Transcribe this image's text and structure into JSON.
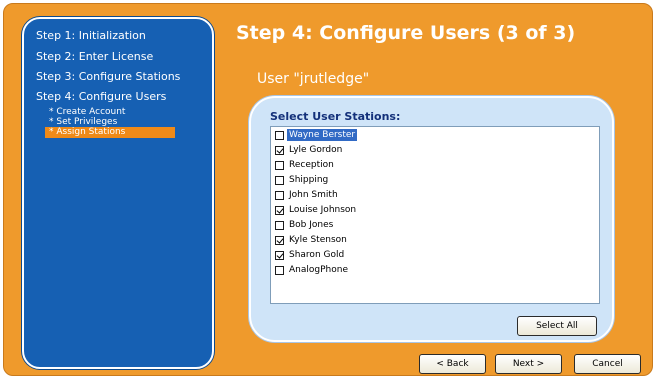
{
  "sidebar": {
    "steps": [
      {
        "label": "Step 1: Initialization"
      },
      {
        "label": "Step 2: Enter License"
      },
      {
        "label": "Step 3: Configure Stations"
      },
      {
        "label": "Step 4: Configure Users"
      }
    ],
    "substeps": [
      {
        "label": "* Create Account"
      },
      {
        "label": "* Set Privileges"
      },
      {
        "label": "* Assign Stations",
        "active": true
      }
    ]
  },
  "main": {
    "heading": "Step 4: Configure Users (3 of 3)",
    "user_label": "User \"jrutledge\"",
    "panel_title": "Select User Stations:",
    "stations": [
      {
        "label": "Wayne Berster",
        "checked": false,
        "highlighted": true
      },
      {
        "label": "Lyle Gordon",
        "checked": true
      },
      {
        "label": "Reception",
        "checked": false
      },
      {
        "label": "Shipping",
        "checked": false
      },
      {
        "label": "John Smith",
        "checked": false
      },
      {
        "label": "Louise Johnson",
        "checked": true
      },
      {
        "label": "Bob Jones",
        "checked": false
      },
      {
        "label": "Kyle Stenson",
        "checked": true
      },
      {
        "label": "Sharon Gold",
        "checked": true
      },
      {
        "label": "AnalogPhone",
        "checked": false
      }
    ],
    "select_all_label": "Select All"
  },
  "footer": {
    "back_label": "< Back",
    "next_label": "Next >",
    "cancel_label": "Cancel"
  },
  "colors": {
    "frame_orange": "#ef9a2c",
    "sidebar_blue": "#1660b3",
    "panel_blue": "#cfe4f8",
    "active_substep": "#ef8a18",
    "selection_blue": "#316ac5"
  }
}
